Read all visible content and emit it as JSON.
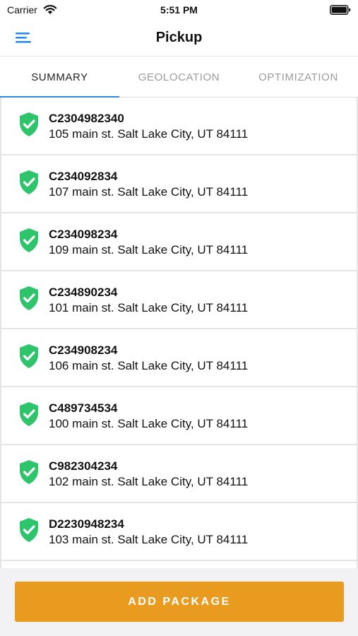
{
  "status_bar": {
    "carrier": "Carrier",
    "time": "5:51 PM"
  },
  "header": {
    "title": "Pickup",
    "menu_icon": "hamburger-menu-icon"
  },
  "tabs": [
    {
      "label": "SUMMARY",
      "active": true
    },
    {
      "label": "GEOLOCATION",
      "active": false
    },
    {
      "label": "OPTIMIZATION",
      "active": false
    }
  ],
  "packages": [
    {
      "id": "C2304982340",
      "address": "105 main st. Salt Lake City, UT 84111",
      "status_icon": "shield-check-icon"
    },
    {
      "id": "C234092834",
      "address": "107 main st. Salt Lake City, UT 84111",
      "status_icon": "shield-check-icon"
    },
    {
      "id": "C234098234",
      "address": "109 main st. Salt Lake City, UT 84111",
      "status_icon": "shield-check-icon"
    },
    {
      "id": "C234890234",
      "address": "101 main st. Salt Lake City, UT 84111",
      "status_icon": "shield-check-icon"
    },
    {
      "id": "C234908234",
      "address": "106 main st. Salt Lake City, UT 84111",
      "status_icon": "shield-check-icon"
    },
    {
      "id": "C489734534",
      "address": "100 main st. Salt Lake City, UT 84111",
      "status_icon": "shield-check-icon"
    },
    {
      "id": "C982304234",
      "address": "102 main st. Salt Lake City, UT 84111",
      "status_icon": "shield-check-icon"
    },
    {
      "id": "D2230948234",
      "address": "103 main st. Salt Lake City, UT 84111",
      "status_icon": "shield-check-icon"
    }
  ],
  "footer": {
    "add_button_label": "ADD PACKAGE"
  },
  "colors": {
    "accent_blue": "#2d8ae6",
    "shield_green": "#2ec46b",
    "button_orange": "#e99b1f"
  }
}
